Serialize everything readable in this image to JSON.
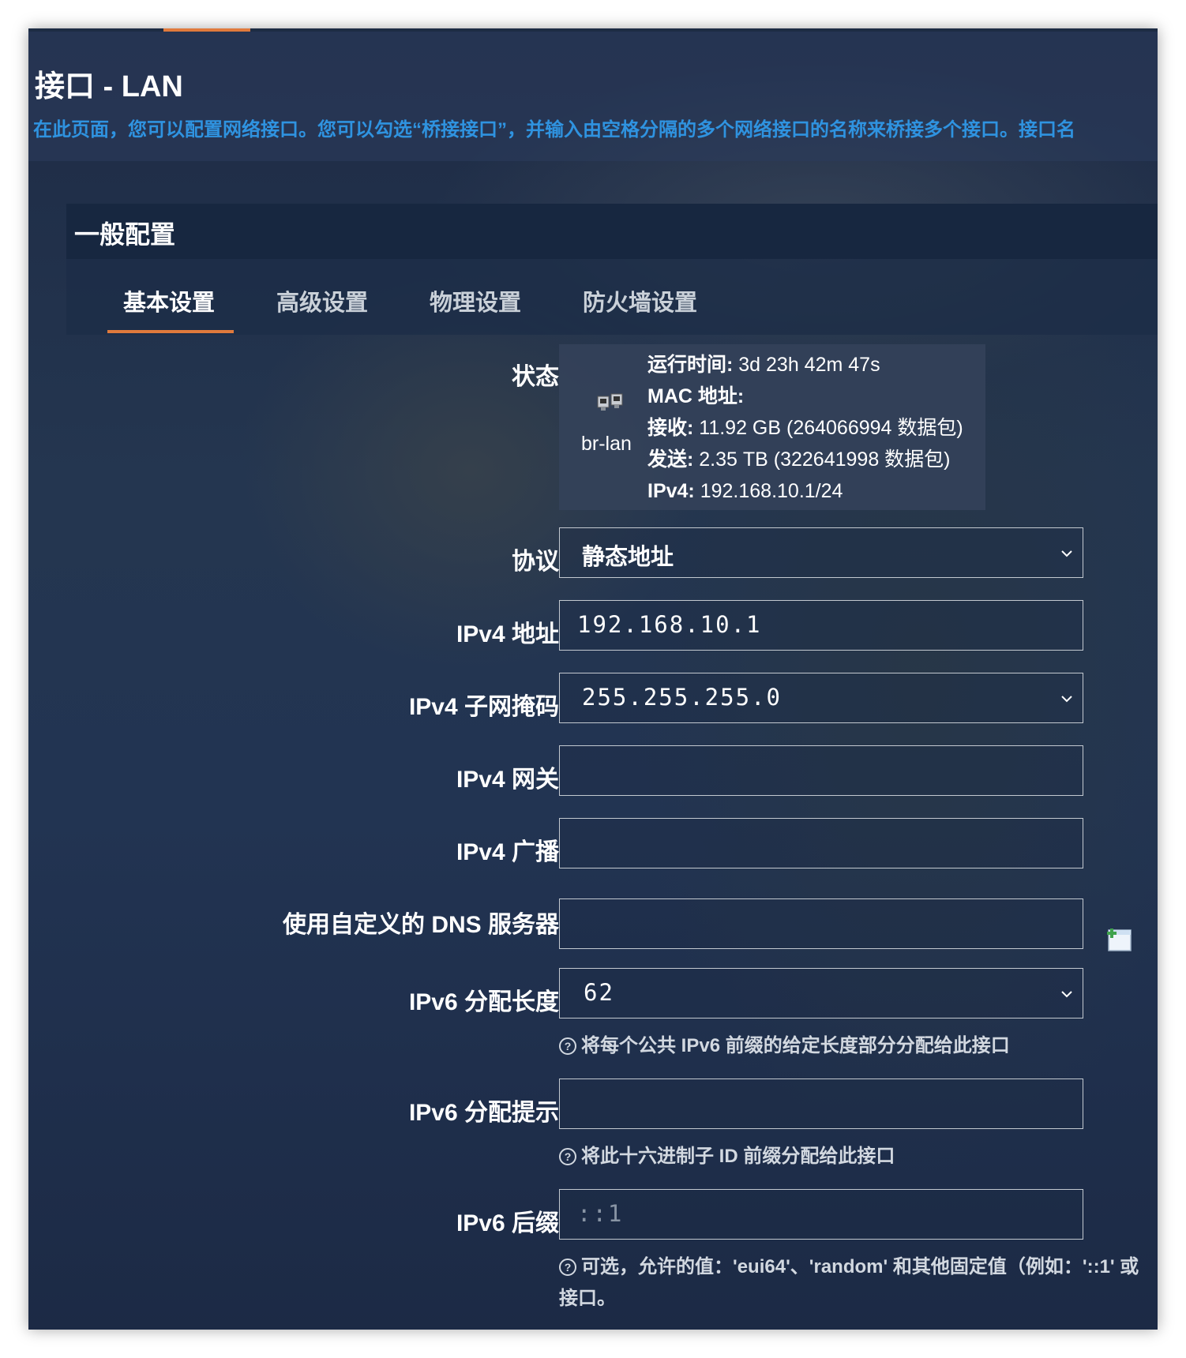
{
  "header": {
    "title": "接口 - LAN",
    "description": "在此页面，您可以配置网络接口。您可以勾选“桥接接口”，并输入由空格分隔的多个网络接口的名称来桥接多个接口。接口名"
  },
  "section": {
    "title": "一般配置",
    "tabs": [
      {
        "label": "基本设置",
        "active": true
      },
      {
        "label": "高级设置",
        "active": false
      },
      {
        "label": "物理设置",
        "active": false
      },
      {
        "label": "防火墙设置",
        "active": false
      }
    ]
  },
  "status": {
    "label": "状态",
    "ifname": "br-lan",
    "uptime_key": "运行时间:",
    "uptime_val": " 3d 23h 42m 47s",
    "mac_key": "MAC 地址:",
    "mac_val": "",
    "rx_key": "接收:",
    "rx_val": " 11.92 GB (264066994 数据包)",
    "tx_key": "发送:",
    "tx_val": " 2.35 TB (322641998 数据包)",
    "ipv4_key": "IPv4:",
    "ipv4_val": " 192.168.10.1/24"
  },
  "fields": {
    "protocol": {
      "label": "协议",
      "value": "静态地址"
    },
    "ipv4_addr": {
      "label": "IPv4 地址",
      "value": "192.168.10.1"
    },
    "ipv4_mask": {
      "label": "IPv4 子网掩码",
      "value": "255.255.255.0"
    },
    "ipv4_gw": {
      "label": "IPv4 网关",
      "value": ""
    },
    "ipv4_bcast": {
      "label": "IPv4 广播",
      "value": ""
    },
    "dns": {
      "label": "使用自定义的 DNS 服务器",
      "value": ""
    },
    "ip6_len": {
      "label": "IPv6 分配长度",
      "value": "62",
      "hint": "将每个公共 IPv6 前缀的给定长度部分分配给此接口"
    },
    "ip6_hint": {
      "label": "IPv6 分配提示",
      "value": "",
      "hint": "将此十六进制子 ID 前缀分配给此接口"
    },
    "ip6_suffix": {
      "label": "IPv6 后缀",
      "placeholder": "::1",
      "hint_line1": "可选，允许的值：'eui64'、'random' 和其他固定值（例如：'::1' 或",
      "hint_line2": "接口。"
    }
  },
  "colors": {
    "accent": "#e07a3c",
    "link": "#2f93e0",
    "panel": "#172740"
  },
  "icons": {
    "status": "network-ports-icon",
    "add": "add-entry-icon",
    "help": "help-icon",
    "chevron": "chevron-down-icon"
  }
}
